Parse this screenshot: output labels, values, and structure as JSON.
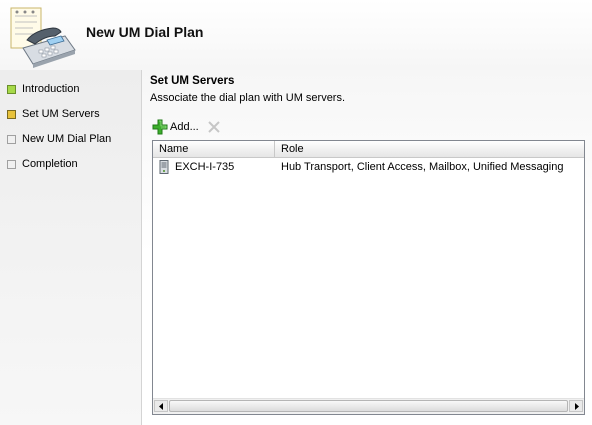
{
  "header": {
    "title": "New UM Dial Plan"
  },
  "nav": {
    "steps": [
      {
        "label": "Introduction",
        "state": "done"
      },
      {
        "label": "Set UM Servers",
        "state": "current"
      },
      {
        "label": "New UM Dial Plan",
        "state": "pending"
      },
      {
        "label": "Completion",
        "state": "pending"
      }
    ]
  },
  "content": {
    "heading": "Set UM Servers",
    "description": "Associate the dial plan with UM servers.",
    "toolbar": {
      "add_label": "Add...",
      "add_icon": "green-plus-icon",
      "remove_icon": "red-x-icon"
    },
    "list": {
      "columns": [
        "Name",
        "Role"
      ],
      "rows": [
        {
          "name": "EXCH-I-735",
          "role": "Hub Transport, Client Access, Mailbox, Unified Messaging"
        }
      ]
    }
  },
  "colors": {
    "done": "#a6d948",
    "current": "#e8c23a",
    "pending": "#f0f0f0",
    "add_icon": "#3cae2c"
  }
}
